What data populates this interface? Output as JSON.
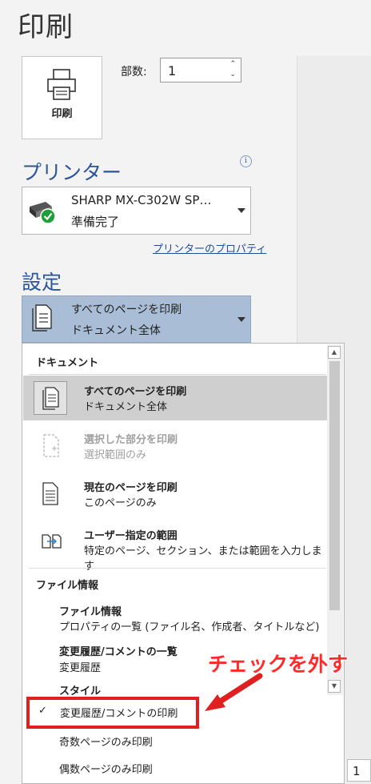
{
  "title": "印刷",
  "print_button": {
    "label": "印刷"
  },
  "copies": {
    "label": "部数:",
    "value": "1"
  },
  "printer": {
    "heading": "プリンター",
    "name": "SHARP MX-C302W SP…",
    "status": "準備完了",
    "properties_link": "プリンターのプロパティ"
  },
  "settings": {
    "heading": "設定",
    "selected_line1": "すべてのページを印刷",
    "selected_line2": "ドキュメント全体"
  },
  "menu": {
    "section_document": "ドキュメント",
    "items": [
      {
        "title": "すべてのページを印刷",
        "desc": "ドキュメント全体"
      },
      {
        "title": "選択した部分を印刷",
        "desc": "選択範囲のみ"
      },
      {
        "title": "現在のページを印刷",
        "desc": "このページのみ"
      },
      {
        "title": "ユーザー指定の範囲",
        "desc": "特定のページ、セクション、または範囲を入力します"
      }
    ],
    "section_fileinfo": "ファイル情報",
    "fileinfo_title": "ファイル情報",
    "fileinfo_desc": "プロパティの一覧 (ファイル名、作成者、タイトルなど)",
    "history_title": "変更履歴/コメントの一覧",
    "history_desc": "変更履歴",
    "styles": "スタイル",
    "checked_item": "変更履歴/コメントの印刷",
    "check_mark": "✓",
    "odd_pages": "奇数ページのみ印刷",
    "even_pages": "偶数ページのみ印刷"
  },
  "annotation": {
    "text": "チェックを外す",
    "color": "#ff2a2a"
  },
  "page_number_field": "1",
  "colors": {
    "accent": "#2b579a",
    "selected_dropdown": "#a9bed6",
    "highlight": "#e02020"
  }
}
